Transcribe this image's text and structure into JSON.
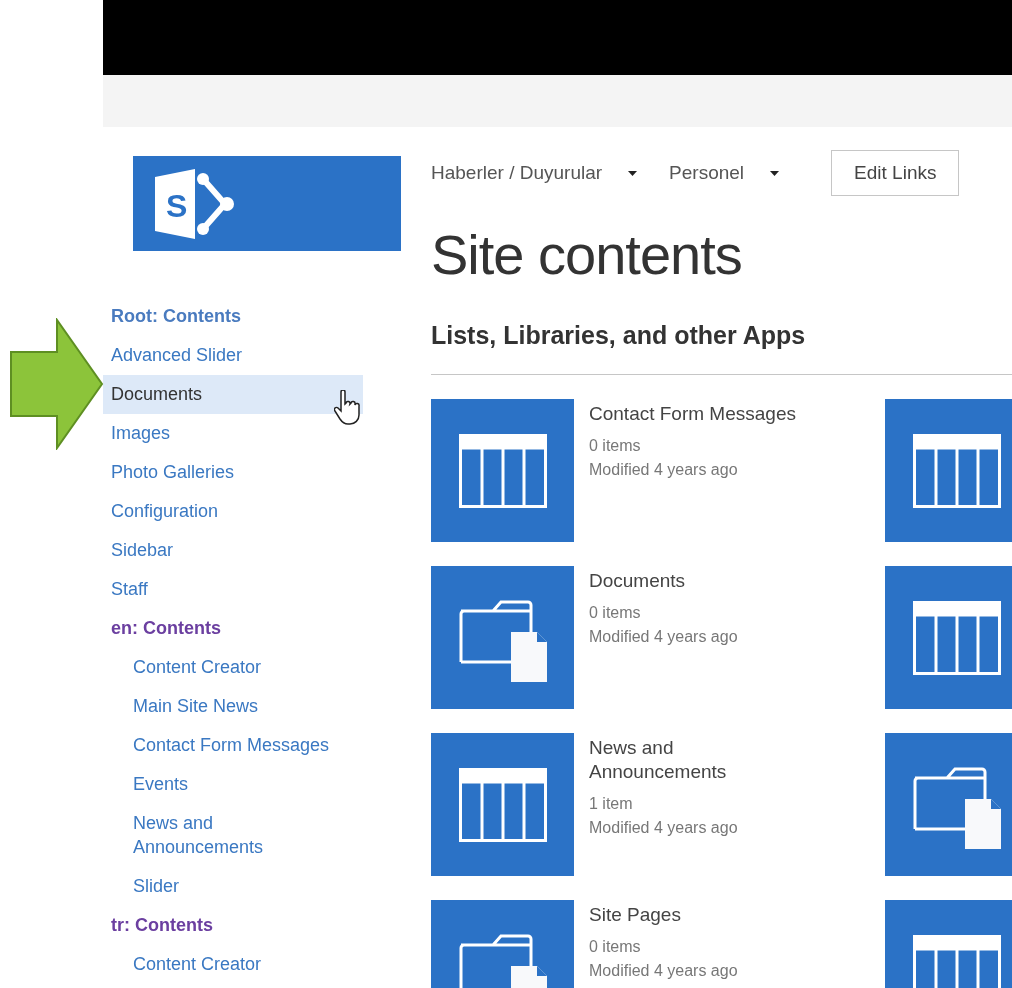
{
  "top_nav": [
    {
      "label": "Haberler / Duyurular",
      "has_menu": true
    },
    {
      "label": "Personel",
      "has_menu": true
    }
  ],
  "logo_letter": "S",
  "edit_links": "Edit Links",
  "title": "Site contents",
  "section_heading": "Lists, Libraries, and other Apps",
  "sidebar": [
    {
      "label": "Root: Contents",
      "kind": "heading",
      "visited": false,
      "selected": false
    },
    {
      "label": "Advanced Slider",
      "kind": "link",
      "selected": false
    },
    {
      "label": "Documents",
      "kind": "link",
      "selected": true
    },
    {
      "label": "Images",
      "kind": "link",
      "selected": false
    },
    {
      "label": "Photo Galleries",
      "kind": "link",
      "selected": false
    },
    {
      "label": "Configuration",
      "kind": "link",
      "selected": false
    },
    {
      "label": "Sidebar",
      "kind": "link",
      "selected": false
    },
    {
      "label": "Staff",
      "kind": "link",
      "selected": false
    },
    {
      "label": "en: Contents",
      "kind": "heading",
      "visited": true,
      "selected": false,
      "children": [
        {
          "label": "Content Creator",
          "kind": "link",
          "selected": false
        },
        {
          "label": "Main Site News",
          "kind": "link",
          "selected": false
        },
        {
          "label": "Contact Form Messages",
          "kind": "link",
          "selected": false
        },
        {
          "label": "Events",
          "kind": "link",
          "selected": false
        },
        {
          "label": "News and Announcements",
          "kind": "link",
          "selected": false
        },
        {
          "label": "Slider",
          "kind": "link",
          "selected": false
        }
      ]
    },
    {
      "label": "tr: Contents",
      "kind": "heading",
      "visited": true,
      "selected": false,
      "children": [
        {
          "label": "Content Creator",
          "kind": "link",
          "selected": false
        }
      ]
    }
  ],
  "tiles": [
    {
      "kind": "list",
      "name": "Contact Form Messages",
      "count": "0 items",
      "modified": "Modified 4 years ago"
    },
    {
      "kind": "list"
    },
    {
      "kind": "library",
      "name": "Documents",
      "count": "0 items",
      "modified": "Modified 4 years ago"
    },
    {
      "kind": "list"
    },
    {
      "kind": "list",
      "name": "News and Announcements",
      "count": "1 item",
      "modified": "Modified 4 years ago"
    },
    {
      "kind": "library"
    },
    {
      "kind": "library",
      "name": "Site Pages",
      "count": "0 items",
      "modified": "Modified 4 years ago"
    },
    {
      "kind": "list"
    }
  ]
}
